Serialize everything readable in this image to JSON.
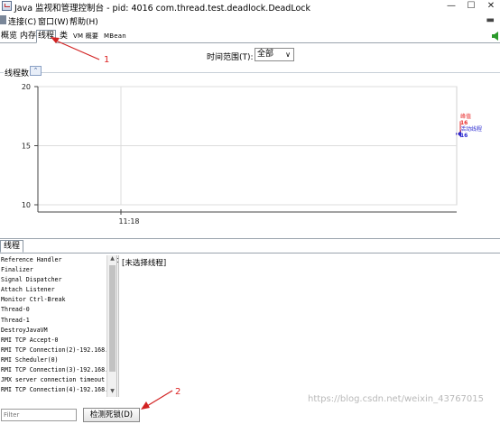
{
  "window": {
    "title": "Java 监视和管理控制台 - pid: 4016 com.thread.test.deadlock.DeadLock",
    "minimize": "—",
    "maximize": "☐",
    "close": "✕"
  },
  "menu": {
    "items": [
      "连接(C)",
      "窗口(W)",
      "帮助(H)"
    ],
    "right_icon": "▬"
  },
  "tabs": [
    {
      "label": "概览"
    },
    {
      "label": "内存"
    },
    {
      "label": "线程"
    },
    {
      "label": "类"
    },
    {
      "label": "VM 概要"
    },
    {
      "label": "MBean"
    }
  ],
  "active_tab": "线程",
  "time_range": {
    "label": "时间范围(T):",
    "value": "全部"
  },
  "chart_section": {
    "title": "线程数",
    "collapse_icon": "chevron-up-icon"
  },
  "chart_data": {
    "type": "line",
    "title": "",
    "xlabel": "",
    "ylabel": "",
    "ylim": [
      10,
      20
    ],
    "y_ticks": [
      10,
      15,
      20
    ],
    "x_ticks": [
      "11:18"
    ],
    "grid": true,
    "series": [
      {
        "name": "峰值",
        "value": 16,
        "color": "#e83030"
      },
      {
        "name": "活动线程",
        "value": 16,
        "color": "#2a2ad0"
      }
    ]
  },
  "lower": {
    "tab_label": "线程",
    "threads": [
      "Reference Handler",
      "Finalizer",
      "Signal Dispatcher",
      "Attach Listener",
      "Monitor Ctrl-Break",
      "Thread-0",
      "Thread-1",
      "DestroyJavaVM",
      "RMI TCP Accept-0",
      "RMI TCP Connection(2)-192.168.",
      "RMI Scheduler(0)",
      "RMI TCP Connection(3)-192.168.",
      "JMX server connection timeout",
      "RMI TCP Connection(4)-192.168."
    ],
    "detail_text": "[未选择线程]",
    "filter_placeholder": "Filter",
    "detect_button": "检测死锁(D)"
  },
  "annotations": [
    {
      "label": "1"
    },
    {
      "label": "2"
    }
  ],
  "watermark": "https://blog.csdn.net/weixin_43767015",
  "colors": {
    "annotation": "#d22222",
    "accent_green": "#2c9a2c",
    "peak": "#e83030",
    "live": "#2a2ad0"
  }
}
